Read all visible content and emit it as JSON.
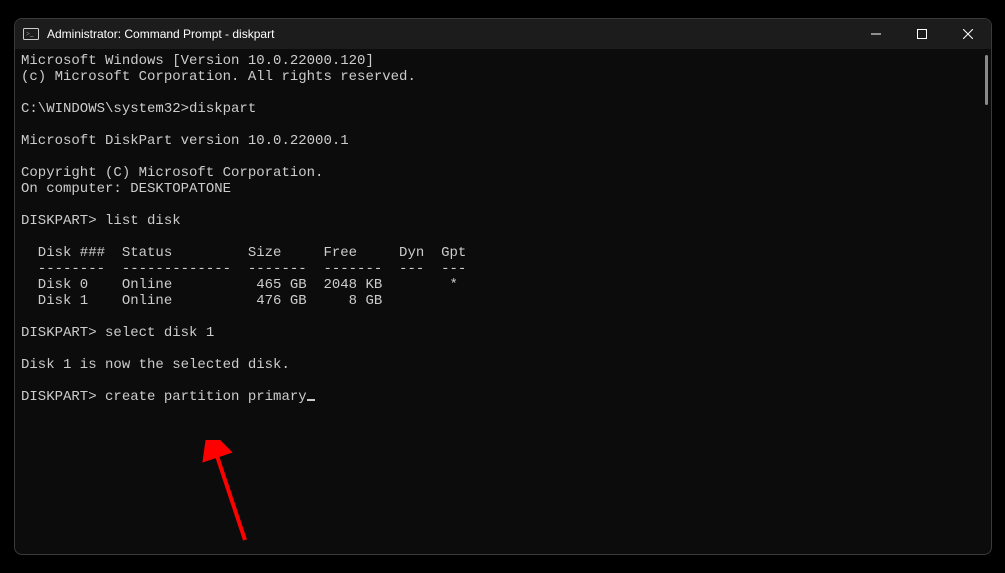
{
  "titlebar": {
    "title": "Administrator: Command Prompt - diskpart"
  },
  "term": {
    "l1": "Microsoft Windows [Version 10.0.22000.120]",
    "l2": "(c) Microsoft Corporation. All rights reserved.",
    "l3": "",
    "l4": "C:\\WINDOWS\\system32>diskpart",
    "l5": "",
    "l6": "Microsoft DiskPart version 10.0.22000.1",
    "l7": "",
    "l8": "Copyright (C) Microsoft Corporation.",
    "l9": "On computer: DESKTOPATONE",
    "l10": "",
    "l11": "DISKPART> list disk",
    "l12": "",
    "l13": "  Disk ###  Status         Size     Free     Dyn  Gpt",
    "l14": "  --------  -------------  -------  -------  ---  ---",
    "l15": "  Disk 0    Online          465 GB  2048 KB        *",
    "l16": "  Disk 1    Online          476 GB     8 GB",
    "l17": "",
    "l18": "DISKPART> select disk 1",
    "l19": "",
    "l20": "Disk 1 is now the selected disk.",
    "l21": "",
    "l22": "DISKPART> create partition primary"
  },
  "annotation": {
    "arrow_color": "#ff0000"
  }
}
